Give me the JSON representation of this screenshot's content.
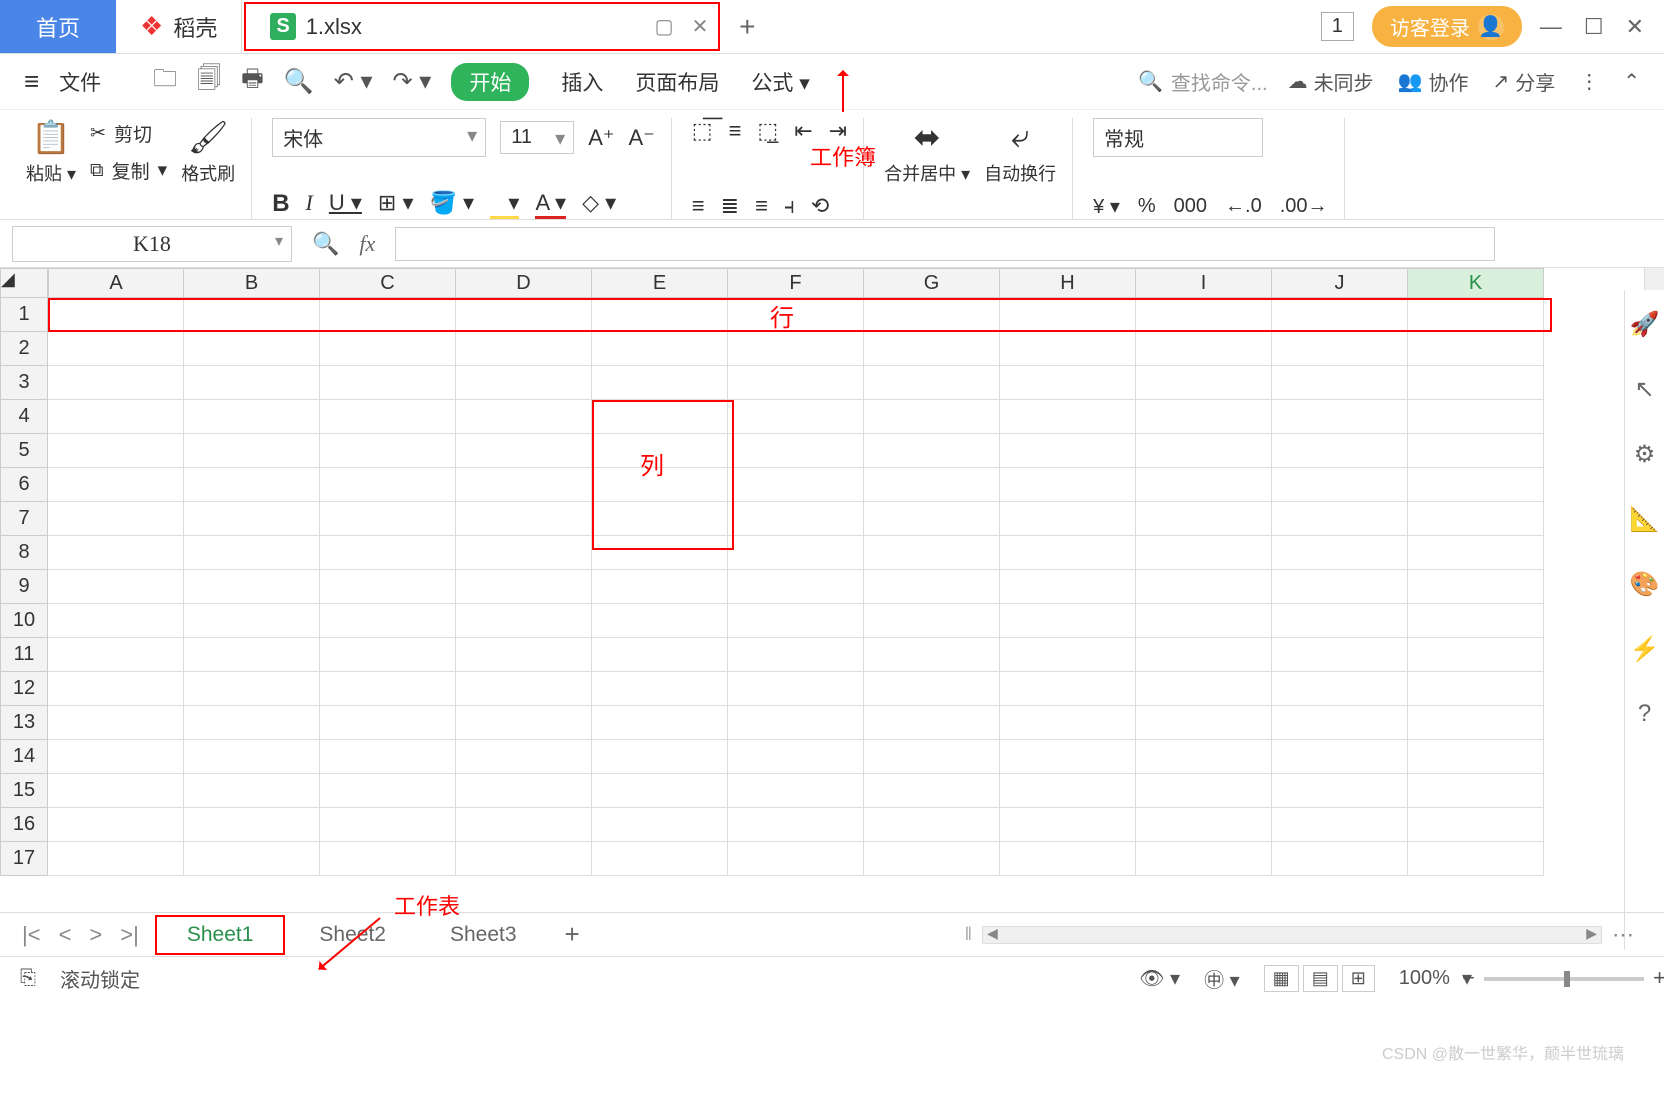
{
  "tabs": {
    "home": "首页",
    "dk": "稻壳",
    "file": "1.xlsx",
    "one": "1",
    "guest": "访客登录"
  },
  "menu": {
    "file": "文件",
    "start": "开始",
    "insert": "插入",
    "layout": "页面布局",
    "formula": "公式",
    "search_ph": "查找命令...",
    "unsync": "未同步",
    "collab": "协作",
    "share": "分享"
  },
  "ribbon": {
    "paste": "粘贴",
    "cut": "剪切",
    "copy": "复制",
    "brush": "格式刷",
    "font": "宋体",
    "size": "11",
    "merge": "合并居中",
    "wrap": "自动换行",
    "numfmt": "常规",
    "currency": "¥",
    "percent": "%",
    "thousands": "000",
    "dec_inc": "←.0",
    "dec_dec": ".00→",
    "wb_label": "工作簿"
  },
  "fx": {
    "name": "K18"
  },
  "grid": {
    "cols": [
      "A",
      "B",
      "C",
      "D",
      "E",
      "F",
      "G",
      "H",
      "I",
      "J",
      "K"
    ],
    "active_col": "K",
    "rows": [
      "1",
      "2",
      "3",
      "4",
      "5",
      "6",
      "7",
      "8",
      "9",
      "10",
      "11",
      "12",
      "13",
      "14",
      "15",
      "16",
      "17"
    ],
    "row_label": "行",
    "col_label": "列"
  },
  "sheets": {
    "s1": "Sheet1",
    "s2": "Sheet2",
    "s3": "Sheet3",
    "ws_label": "工作表"
  },
  "status": {
    "lock": "滚动锁定",
    "zoom": "100%"
  },
  "watermark": "CSDN @散一世繁华，颠半世琉璃"
}
